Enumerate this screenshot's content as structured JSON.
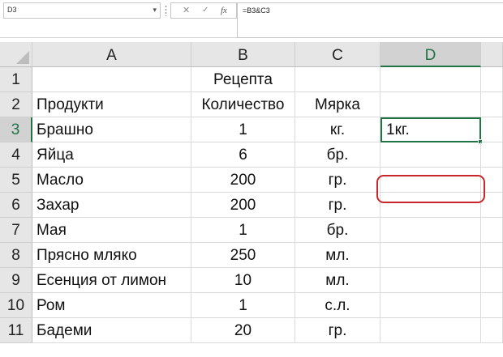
{
  "formula_bar": {
    "name_box": "D3",
    "name_box_caret": "▾",
    "cancel_glyph": "✕",
    "enter_glyph": "✓",
    "function_glyph": "fx",
    "formula": "=B3&C3"
  },
  "columns": [
    "A",
    "B",
    "C",
    "D"
  ],
  "selected_column": "D",
  "rows": [
    {
      "num": "1",
      "a": "",
      "b": "Рецепта",
      "c": "",
      "d": ""
    },
    {
      "num": "2",
      "a": "Продукти",
      "b": "Количество",
      "c": "Мярка",
      "d": ""
    },
    {
      "num": "3",
      "a": "Брашно",
      "b": "1",
      "c": "кг.",
      "d": "1кг."
    },
    {
      "num": "4",
      "a": "Яйца",
      "b": "6",
      "c": "бр.",
      "d": ""
    },
    {
      "num": "5",
      "a": "Масло",
      "b": "200",
      "c": "гр.",
      "d": ""
    },
    {
      "num": "6",
      "a": "Захар",
      "b": "200",
      "c": "гр.",
      "d": ""
    },
    {
      "num": "7",
      "a": "Мая",
      "b": "1",
      "c": "бр.",
      "d": ""
    },
    {
      "num": "8",
      "a": "Прясно мляко",
      "b": "250",
      "c": "мл.",
      "d": ""
    },
    {
      "num": "9",
      "a": "Есенция от лимон",
      "b": "10",
      "c": "мл.",
      "d": ""
    },
    {
      "num": "10",
      "a": "Ром",
      "b": "1",
      "c": "с.л.",
      "d": ""
    },
    {
      "num": "11",
      "a": "Бадеми",
      "b": "20",
      "c": "гр.",
      "d": ""
    }
  ],
  "selected_row": "3",
  "colors": {
    "accent": "#217346",
    "highlight_ring": "#c8262a"
  }
}
